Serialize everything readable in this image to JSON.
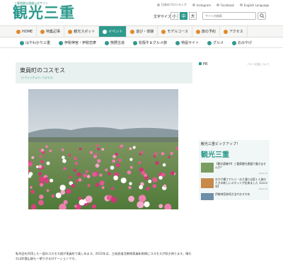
{
  "header": {
    "tagline": "三重県観光連盟公式サイト",
    "logo": "観光三重",
    "links": [
      "日本のフロンティア",
      "Instagram",
      "Facebook",
      "English Language"
    ],
    "font_size_label": "文字サイズ",
    "font_sizes": [
      "小",
      "中",
      "大"
    ],
    "search_placeholder": "サイト内検索"
  },
  "nav1": [
    {
      "label": "HOME",
      "icon": "home-icon",
      "active": false
    },
    {
      "label": "特集記事",
      "icon": "book-icon",
      "active": false
    },
    {
      "label": "観光スポット",
      "icon": "camera-icon",
      "active": false
    },
    {
      "label": "イベント",
      "icon": "calendar-icon",
      "active": true
    },
    {
      "label": "遊び・体験",
      "icon": "activity-icon",
      "active": false
    },
    {
      "label": "モデルコース",
      "icon": "route-icon",
      "active": false
    },
    {
      "label": "旅の予約",
      "icon": "bed-icon",
      "active": false
    },
    {
      "label": "アクセス",
      "icon": "train-icon",
      "active": false
    }
  ],
  "nav2": [
    {
      "label": "はやわかり三重",
      "icon": "map-icon"
    },
    {
      "label": "伊勢神宮・伊勢志摩",
      "icon": "shrine-icon"
    },
    {
      "label": "熊野古道",
      "icon": "trail-icon"
    },
    {
      "label": "松阪牛＆グルメ旅",
      "icon": "beef-icon"
    },
    {
      "label": "特設サイト",
      "icon": "star-icon"
    },
    {
      "label": "グルメ",
      "icon": "dish-icon"
    },
    {
      "label": "おみやげ",
      "icon": "gift-icon"
    }
  ],
  "article": {
    "title": "東員町のコスモス",
    "subtitle": "（トウインチョウノコスモス）",
    "body": "転作田を利用した一面のコスモス畑が東員町で楽しめます。2022年は、三岐鉄道北勢線東員駅南側にコスモスが咲き誇ります。晴れれば鈴鹿山脈も一望できるロケーションです。"
  },
  "sidebar": {
    "pr_label": "PR",
    "pr_note": "バナー広告について",
    "pickup_heading": "観光三重ピックアップ！",
    "pickup_logo": "観光三重",
    "cards": [
      {
        "text": "【観光募集中】三重県観光連盟で働きませんか？",
        "date": "2022.10"
      },
      {
        "text": "おかげ横丁アルバ・おさ通りは家１人旅のときの新しいスポットが出来ました【2022年】",
        "date": "2022.09"
      },
      {
        "text": "伊勢神宮参拝方法やおすすめ",
        "date": ""
      }
    ]
  },
  "colors": {
    "accent": "#2f9a8e",
    "sky": "#c9d3dc",
    "field": "#6f8f4a",
    "flower_pink": "#e35a93"
  }
}
